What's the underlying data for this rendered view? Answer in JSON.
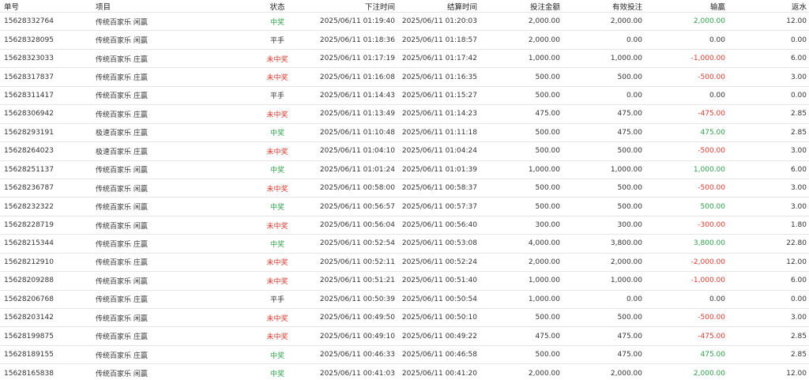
{
  "colors": {
    "win": "#2e9e4a",
    "lose": "#d93a2e",
    "neutral": "#333333"
  },
  "headers": {
    "id": "单号",
    "item": "项目",
    "status": "状态",
    "bet_time": "下注时间",
    "settle_time": "结算时间",
    "amount": "投注金额",
    "valid": "有效投注",
    "winloss": "输赢",
    "rebate": "返水"
  },
  "rows": [
    {
      "id": "15628332764",
      "item": "传统百家乐 闲赢",
      "status": "中奖",
      "result": "win",
      "bet_time": "2025/06/11 01:19:40",
      "settle_time": "2025/06/11 01:20:03",
      "amount": "2,000.00",
      "valid": "2,000.00",
      "winloss": "2,000.00",
      "sign": "pos",
      "rebate": "12.00"
    },
    {
      "id": "15628328095",
      "item": "传统百家乐 闲赢",
      "status": "平手",
      "result": "draw",
      "bet_time": "2025/06/11 01:18:36",
      "settle_time": "2025/06/11 01:18:57",
      "amount": "2,000.00",
      "valid": "0.00",
      "winloss": "0.00",
      "sign": "zero",
      "rebate": "0.00"
    },
    {
      "id": "15628323033",
      "item": "传统百家乐 庄赢",
      "status": "未中奖",
      "result": "lose",
      "bet_time": "2025/06/11 01:17:19",
      "settle_time": "2025/06/11 01:17:42",
      "amount": "1,000.00",
      "valid": "1,000.00",
      "winloss": "-1,000.00",
      "sign": "neg",
      "rebate": "6.00"
    },
    {
      "id": "15628317837",
      "item": "传统百家乐 庄赢",
      "status": "未中奖",
      "result": "lose",
      "bet_time": "2025/06/11 01:16:08",
      "settle_time": "2025/06/11 01:16:35",
      "amount": "500.00",
      "valid": "500.00",
      "winloss": "-500.00",
      "sign": "neg",
      "rebate": "3.00"
    },
    {
      "id": "15628311417",
      "item": "传统百家乐 庄赢",
      "status": "平手",
      "result": "draw",
      "bet_time": "2025/06/11 01:14:43",
      "settle_time": "2025/06/11 01:15:27",
      "amount": "500.00",
      "valid": "0.00",
      "winloss": "0.00",
      "sign": "zero",
      "rebate": "0.00"
    },
    {
      "id": "15628306942",
      "item": "传统百家乐 庄赢",
      "status": "未中奖",
      "result": "lose",
      "bet_time": "2025/06/11 01:13:49",
      "settle_time": "2025/06/11 01:14:23",
      "amount": "475.00",
      "valid": "475.00",
      "winloss": "-475.00",
      "sign": "neg",
      "rebate": "2.85"
    },
    {
      "id": "15628293191",
      "item": "极速百家乐 庄赢",
      "status": "中奖",
      "result": "win",
      "bet_time": "2025/06/11 01:10:48",
      "settle_time": "2025/06/11 01:11:18",
      "amount": "500.00",
      "valid": "475.00",
      "winloss": "475.00",
      "sign": "pos",
      "rebate": "2.85"
    },
    {
      "id": "15628264023",
      "item": "极速百家乐 庄赢",
      "status": "未中奖",
      "result": "lose",
      "bet_time": "2025/06/11 01:04:10",
      "settle_time": "2025/06/11 01:04:24",
      "amount": "500.00",
      "valid": "500.00",
      "winloss": "-500.00",
      "sign": "neg",
      "rebate": "3.00"
    },
    {
      "id": "15628251137",
      "item": "传统百家乐 闲赢",
      "status": "中奖",
      "result": "win",
      "bet_time": "2025/06/11 01:01:24",
      "settle_time": "2025/06/11 01:01:39",
      "amount": "1,000.00",
      "valid": "1,000.00",
      "winloss": "1,000.00",
      "sign": "pos",
      "rebate": "6.00"
    },
    {
      "id": "15628236787",
      "item": "传统百家乐 闲赢",
      "status": "未中奖",
      "result": "lose",
      "bet_time": "2025/06/11 00:58:00",
      "settle_time": "2025/06/11 00:58:37",
      "amount": "500.00",
      "valid": "500.00",
      "winloss": "-500.00",
      "sign": "neg",
      "rebate": "3.00"
    },
    {
      "id": "15628232322",
      "item": "传统百家乐 闲赢",
      "status": "中奖",
      "result": "win",
      "bet_time": "2025/06/11 00:56:57",
      "settle_time": "2025/06/11 00:57:37",
      "amount": "500.00",
      "valid": "500.00",
      "winloss": "500.00",
      "sign": "pos",
      "rebate": "3.00"
    },
    {
      "id": "15628228719",
      "item": "传统百家乐 闲赢",
      "status": "未中奖",
      "result": "lose",
      "bet_time": "2025/06/11 00:56:04",
      "settle_time": "2025/06/11 00:56:40",
      "amount": "300.00",
      "valid": "300.00",
      "winloss": "-300.00",
      "sign": "neg",
      "rebate": "1.80"
    },
    {
      "id": "15628215344",
      "item": "传统百家乐 庄赢",
      "status": "中奖",
      "result": "win",
      "bet_time": "2025/06/11 00:52:54",
      "settle_time": "2025/06/11 00:53:08",
      "amount": "4,000.00",
      "valid": "3,800.00",
      "winloss": "3,800.00",
      "sign": "pos",
      "rebate": "22.80"
    },
    {
      "id": "15628212910",
      "item": "传统百家乐 庄赢",
      "status": "未中奖",
      "result": "lose",
      "bet_time": "2025/06/11 00:52:11",
      "settle_time": "2025/06/11 00:52:24",
      "amount": "2,000.00",
      "valid": "2,000.00",
      "winloss": "-2,000.00",
      "sign": "neg",
      "rebate": "12.00"
    },
    {
      "id": "15628209288",
      "item": "传统百家乐 闲赢",
      "status": "未中奖",
      "result": "lose",
      "bet_time": "2025/06/11 00:51:21",
      "settle_time": "2025/06/11 00:51:40",
      "amount": "1,000.00",
      "valid": "1,000.00",
      "winloss": "-1,000.00",
      "sign": "neg",
      "rebate": "6.00"
    },
    {
      "id": "15628206768",
      "item": "传统百家乐 庄赢",
      "status": "平手",
      "result": "draw",
      "bet_time": "2025/06/11 00:50:39",
      "settle_time": "2025/06/11 00:50:54",
      "amount": "1,000.00",
      "valid": "0.00",
      "winloss": "0.00",
      "sign": "zero",
      "rebate": "0.00"
    },
    {
      "id": "15628203142",
      "item": "传统百家乐 闲赢",
      "status": "未中奖",
      "result": "lose",
      "bet_time": "2025/06/11 00:49:50",
      "settle_time": "2025/06/11 00:50:10",
      "amount": "500.00",
      "valid": "500.00",
      "winloss": "-500.00",
      "sign": "neg",
      "rebate": "3.00"
    },
    {
      "id": "15628199875",
      "item": "传统百家乐 庄赢",
      "status": "未中奖",
      "result": "lose",
      "bet_time": "2025/06/11 00:49:10",
      "settle_time": "2025/06/11 00:49:22",
      "amount": "475.00",
      "valid": "475.00",
      "winloss": "-475.00",
      "sign": "neg",
      "rebate": "2.85"
    },
    {
      "id": "15628189155",
      "item": "传统百家乐 庄赢",
      "status": "中奖",
      "result": "win",
      "bet_time": "2025/06/11 00:46:33",
      "settle_time": "2025/06/11 00:46:58",
      "amount": "500.00",
      "valid": "475.00",
      "winloss": "475.00",
      "sign": "pos",
      "rebate": "2.85"
    },
    {
      "id": "15628165838",
      "item": "传统百家乐 闲赢",
      "status": "中奖",
      "result": "win",
      "bet_time": "2025/06/11 00:41:03",
      "settle_time": "2025/06/11 00:41:20",
      "amount": "2,000.00",
      "valid": "2,000.00",
      "winloss": "2,000.00",
      "sign": "pos",
      "rebate": "12.00"
    }
  ]
}
